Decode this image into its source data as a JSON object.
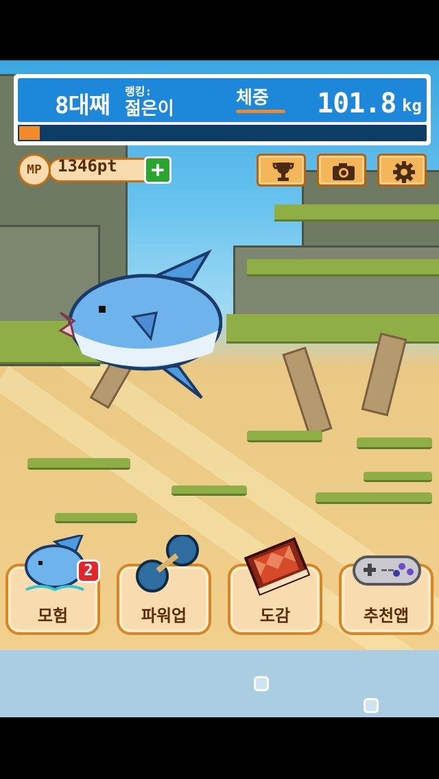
{
  "hud": {
    "generation": "8대째",
    "rank_label": "랭킹:",
    "rank_value": "젊은이",
    "weight_tab": "체중",
    "weight_value": "101.8",
    "weight_unit": "kg",
    "growth_progress": 0.05
  },
  "mp": {
    "icon_text": "MP",
    "points": "1346pt",
    "add_label": "+"
  },
  "toolbar": {
    "icons": [
      "trophy-icon",
      "camera-icon",
      "gear-icon"
    ]
  },
  "menu": {
    "adventure": "모험",
    "adventure_badge": "2",
    "powerup": "파워업",
    "encyclopedia": "도감",
    "recommended": "추천앱"
  },
  "colors": {
    "hud_blue": "#1d88d9",
    "progress_orange": "#f08a2a",
    "button_fill": "#f8dcaf",
    "button_border": "#d98525",
    "plus_green": "#2aa52e",
    "badge_red": "#e3262b"
  }
}
